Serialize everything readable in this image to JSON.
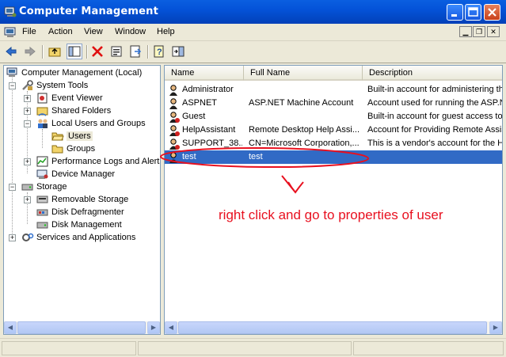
{
  "window": {
    "title": "Computer Management"
  },
  "title_buttons": {
    "minimize": "_",
    "maximize": "□",
    "close": "✕"
  },
  "menu": [
    "File",
    "Action",
    "View",
    "Window",
    "Help"
  ],
  "toolbar_icons": [
    "back-icon",
    "forward-icon",
    "up-folder-icon",
    "show-hide-tree-icon",
    "delete-icon",
    "properties-icon",
    "export-list-icon",
    "help-icon",
    "console-tree-icon"
  ],
  "tree": [
    {
      "label": "Computer Management (Local)",
      "icon": "computer-icon"
    },
    {
      "label": "System Tools",
      "icon": "tools-icon"
    },
    {
      "label": "Event Viewer",
      "icon": "event-viewer-icon"
    },
    {
      "label": "Shared Folders",
      "icon": "shared-folder-icon"
    },
    {
      "label": "Local Users and Groups",
      "icon": "users-groups-icon"
    },
    {
      "label": "Users",
      "icon": "folder-icon"
    },
    {
      "label": "Groups",
      "icon": "folder-icon"
    },
    {
      "label": "Performance Logs and Alerts",
      "icon": "performance-icon"
    },
    {
      "label": "Device Manager",
      "icon": "device-manager-icon"
    },
    {
      "label": "Storage",
      "icon": "storage-icon"
    },
    {
      "label": "Removable Storage",
      "icon": "removable-storage-icon"
    },
    {
      "label": "Disk Defragmenter",
      "icon": "defrag-icon"
    },
    {
      "label": "Disk Management",
      "icon": "disk-management-icon"
    },
    {
      "label": "Services and Applications",
      "icon": "services-icon"
    }
  ],
  "list": {
    "columns": [
      "Name",
      "Full Name",
      "Description"
    ],
    "rows": [
      {
        "name": "Administrator",
        "full_name": "",
        "description": "Built-in account for administering the"
      },
      {
        "name": "ASPNET",
        "full_name": "ASP.NET Machine Account",
        "description": "Account used for running the ASP.NET"
      },
      {
        "name": "Guest",
        "full_name": "",
        "description": "Built-in account for guest access to the"
      },
      {
        "name": "HelpAssistant",
        "full_name": "Remote Desktop Help Assi...",
        "description": "Account for Providing Remote Assistance"
      },
      {
        "name": "SUPPORT_38...",
        "full_name": "CN=Microsoft Corporation,...",
        "description": "This is a vendor's account for the Help"
      },
      {
        "name": "test",
        "full_name": "test",
        "description": ""
      }
    ],
    "selected_index": 5
  },
  "annotation": {
    "text": "right click and go to properties of user",
    "color": "#e8101f"
  },
  "colors": {
    "selection": "#316ac5",
    "title_bar": "#0453d8",
    "annotation": "#e8101f"
  }
}
